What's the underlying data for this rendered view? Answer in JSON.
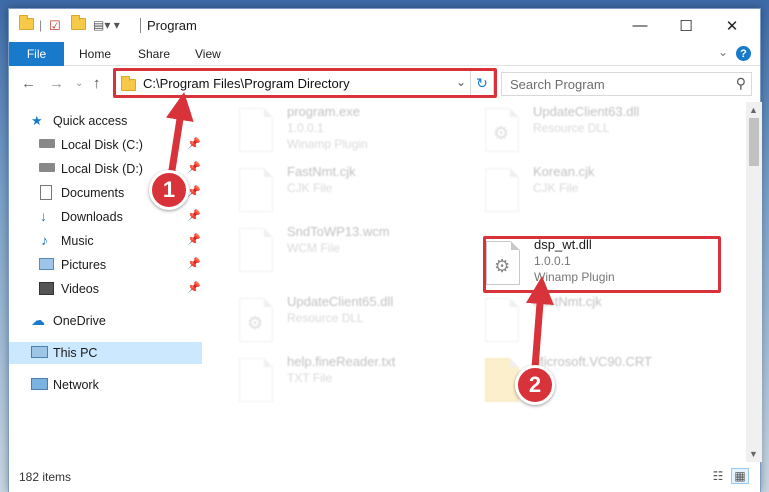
{
  "window": {
    "title": "Program",
    "controls": {
      "minimize": "—",
      "maximize": "☐",
      "close": "✕"
    }
  },
  "ribbon": {
    "tabs": [
      "File",
      "Home",
      "Share",
      "View"
    ],
    "help": "?"
  },
  "address": {
    "path": "C:\\Program Files\\Program Directory",
    "refresh": "↻"
  },
  "search": {
    "placeholder": "Search Program"
  },
  "sidebar": {
    "quick_access": "Quick access",
    "items": [
      {
        "label": "Local Disk (C:)",
        "icon": "drive-icon",
        "pinned": true
      },
      {
        "label": "Local Disk (D:)",
        "icon": "drive-icon",
        "pinned": true
      },
      {
        "label": "Documents",
        "icon": "documents-icon",
        "pinned": true
      },
      {
        "label": "Downloads",
        "icon": "downloads-icon",
        "pinned": true
      },
      {
        "label": "Music",
        "icon": "music-icon",
        "pinned": true
      },
      {
        "label": "Pictures",
        "icon": "pictures-icon",
        "pinned": true
      },
      {
        "label": "Videos",
        "icon": "videos-icon",
        "pinned": true
      }
    ],
    "onedrive": "OneDrive",
    "this_pc": "This PC",
    "network": "Network"
  },
  "files": [
    {
      "name": "program.exe",
      "line2": "1.0.0.1",
      "line3": "Winamp Plugin",
      "faded": true,
      "icon": "exe-icon"
    },
    {
      "name": "UpdateClient63.dll",
      "line2": "Resource DLL",
      "line3": "",
      "faded": true,
      "icon": "dll-icon"
    },
    {
      "name": "FastNmt.cjk",
      "line2": "CJK File",
      "line3": "",
      "faded": true,
      "icon": "file-icon"
    },
    {
      "name": "Korean.cjk",
      "line2": "CJK File",
      "line3": "",
      "faded": true,
      "icon": "file-icon"
    },
    {
      "name": "SndToWP13.wcm",
      "line2": "WCM File",
      "line3": "",
      "faded": true,
      "icon": "file-icon"
    },
    {
      "name": "dsp_wt.dll",
      "line2": "1.0.0.1",
      "line3": "Winamp Plugin",
      "faded": false,
      "icon": "dll-icon"
    },
    {
      "name": "UpdateClient65.dll",
      "line2": "Resource DLL",
      "line3": "",
      "faded": true,
      "icon": "dll-icon"
    },
    {
      "name": "FastNmt.cjk",
      "line2": "",
      "line3": "",
      "faded": true,
      "icon": "file-icon"
    },
    {
      "name": "help.fineReader.txt",
      "line2": "TXT File",
      "line3": "",
      "faded": true,
      "icon": "file-icon"
    },
    {
      "name": "Microsoft.VC90.CRT",
      "line2": "",
      "line3": "",
      "faded": true,
      "icon": "folder-icon"
    }
  ],
  "status": {
    "items": "182 items"
  },
  "annotations": {
    "step1": "1",
    "step2": "2",
    "color": "#d8323a"
  }
}
